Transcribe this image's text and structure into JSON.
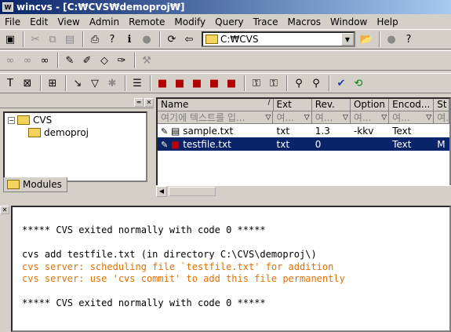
{
  "window": {
    "title": "wincvs - [C:₩CVS₩demoproj₩]"
  },
  "menu": [
    "File",
    "Edit",
    "View",
    "Admin",
    "Remote",
    "Modify",
    "Query",
    "Trace",
    "Macros",
    "Window",
    "Help"
  ],
  "toolbar": {
    "location_value": "C:₩CVS"
  },
  "tree": {
    "root_label": "CVS",
    "child_label": "demoproj",
    "tab_label": "Modules"
  },
  "filelist": {
    "columns": [
      "Name",
      "Ext",
      "Rev.",
      "Option",
      "Encod...",
      "St"
    ],
    "filters": [
      "여기에 텍스트를 입...",
      "여...",
      "여...",
      "여...",
      "여...",
      "여..."
    ],
    "rows": [
      {
        "name": "sample.txt",
        "ext": "txt",
        "rev": "1.3",
        "option": "-kkv",
        "encoding": "Text",
        "status": ""
      },
      {
        "name": "testfile.txt",
        "ext": "txt",
        "rev": "0",
        "option": "",
        "encoding": "Text",
        "status": "M"
      }
    ]
  },
  "output": {
    "lines": [
      {
        "text": "***** CVS exited normally with code 0 *****",
        "color": "#000000"
      },
      {
        "text": "",
        "color": "#000000"
      },
      {
        "text": "cvs add testfile.txt (in directory C:\\CVS\\demoproj\\)",
        "color": "#000000"
      },
      {
        "text": "cvs server: scheduling file `testfile.txt' for addition",
        "color": "#e07000"
      },
      {
        "text": "cvs server: use 'cvs commit' to add this file permanently",
        "color": "#e07000"
      },
      {
        "text": "",
        "color": "#000000"
      },
      {
        "text": "***** CVS exited normally with code 0 *****",
        "color": "#000000"
      }
    ]
  }
}
